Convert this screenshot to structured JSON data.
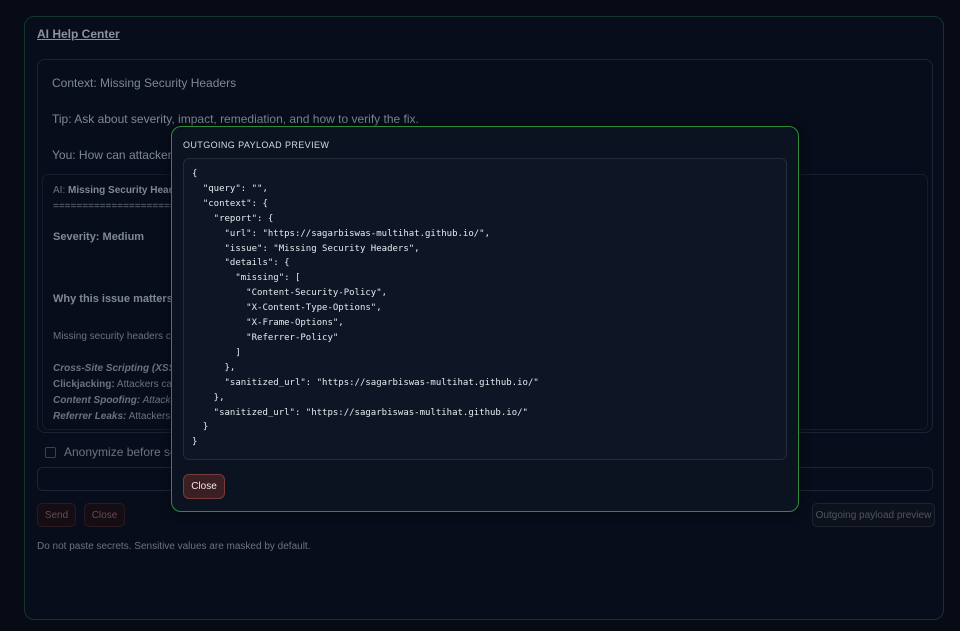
{
  "panel": {
    "title": "AI Help Center",
    "context_line": "Context: Missing Security Headers",
    "tip_line": "Tip: Ask about severity, impact, remediation, and how to verify the fix.",
    "you_line": "You: How can attackers t",
    "ai_prefix": "AI: ",
    "ai_title": "Missing Security Heade",
    "ai_rule": "========================",
    "severity": "Severity: Medium",
    "why_heading": "Why this issue matters",
    "missing_line": "Missing security headers ca",
    "xss_term": "Cross-Site Scripting (XSS):",
    "click_term": "Clickjacking:",
    "click_text": " Attackers can",
    "spoof_term": "Content Spoofing:",
    "spoof_text": " Attacker",
    "ref_term": "Referrer Leaks:",
    "ref_text": " Attackers c",
    "anonymize_label": "Anonymize before sen",
    "send_label": "Send",
    "close_label": "Close",
    "payload_preview_label": "Outgoing payload preview",
    "footer_note": "Do not paste secrets. Sensitive values are masked by default."
  },
  "modal": {
    "title": "OUTGOING PAYLOAD PREVIEW",
    "payload": "{\n  \"query\": \"\",\n  \"context\": {\n    \"report\": {\n      \"url\": \"https://sagarbiswas-multihat.github.io/\",\n      \"issue\": \"Missing Security Headers\",\n      \"details\": {\n        \"missing\": [\n          \"Content-Security-Policy\",\n          \"X-Content-Type-Options\",\n          \"X-Frame-Options\",\n          \"Referrer-Policy\"\n        ]\n      },\n      \"sanitized_url\": \"https://sagarbiswas-multihat.github.io/\"\n    },\n    \"sanitized_url\": \"https://sagarbiswas-multihat.github.io/\"\n  }\n}",
    "close_label": "Close"
  },
  "colors": {
    "modal_border": "#2f8a3c",
    "close_button": "#3a2023",
    "background": "#060b16"
  }
}
